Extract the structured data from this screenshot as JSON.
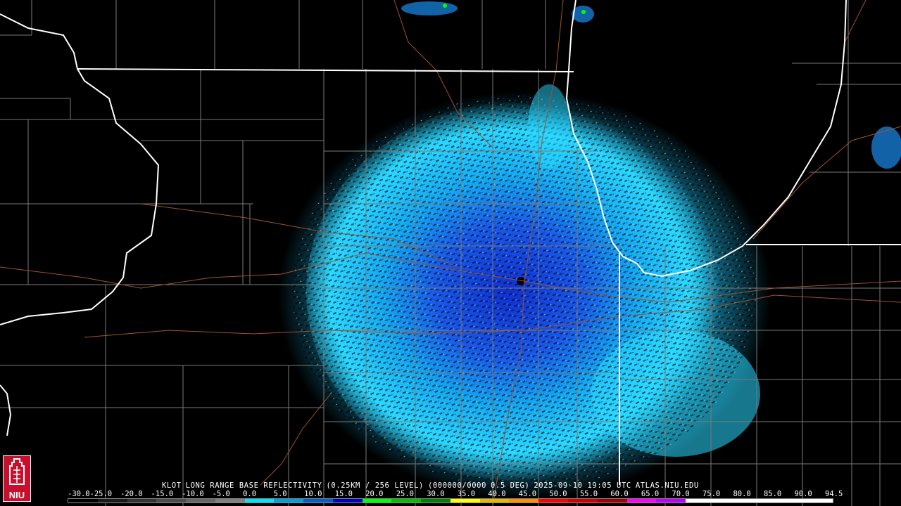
{
  "caption": {
    "station": "KLOT",
    "product": "LONG RANGE BASE REFLECTIVITY",
    "resolution": "(0.25KM / 256 LEVEL)",
    "code": "(000000/0000",
    "tilt": "0.5 DEG)",
    "timestamp": "2025-09-10 19:05 UTC",
    "source": "ATLAS.NIU.EDU"
  },
  "scale": {
    "labels": [
      "-30.0",
      "-25.0",
      "-20.0",
      "-15.0",
      "-10.0",
      "-5.0",
      "0.0",
      "5.0",
      "10.0",
      "15.0",
      "20.0",
      "25.0",
      "30.0",
      "35.0",
      "40.0",
      "45.0",
      "50.0",
      "55.0",
      "60.0",
      "65.0",
      "70.0",
      "75.0",
      "80.0",
      "85.0",
      "90.0",
      "94.5"
    ],
    "colors": [
      "#000000",
      "#1a1a1a",
      "#333333",
      "#4d4d4d",
      "#666666",
      "#808080",
      "#00e5ff",
      "#009fdf",
      "#0060d0",
      "#0000c8",
      "#00ff00",
      "#00c000",
      "#008000",
      "#ffff00",
      "#e6b800",
      "#ff9000",
      "#ff0000",
      "#d00000",
      "#a00000",
      "#ff00ff",
      "#c000ff",
      "#ffffff",
      "#ffffff",
      "#ffffff",
      "#ffffff",
      "#ffffff"
    ]
  },
  "logo": {
    "text": "NIU"
  },
  "colors": {
    "background": "#000000",
    "state_border": "#ffffff",
    "county_border": "#8a8a8a",
    "road": "#a0522d",
    "echo_light": "#2ee6ff",
    "echo_mid": "#00b0f0",
    "echo_dark": "#1040e0"
  }
}
